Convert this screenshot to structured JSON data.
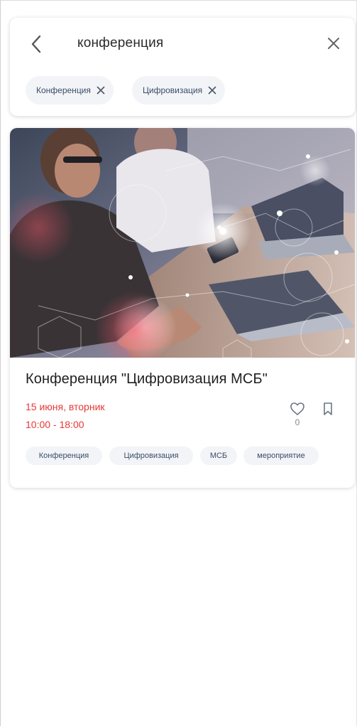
{
  "search": {
    "query": "конференция",
    "filters": [
      {
        "label": "Конференция"
      },
      {
        "label": "Цифровизация"
      }
    ]
  },
  "event": {
    "title": "Конференция \"Цифровизация МСБ\"",
    "date": "15 июня, вторник",
    "time": "10:00 - 18:00",
    "likes": "0",
    "tags": [
      "Конференция",
      "Цифровизация",
      "МСБ",
      "мероприятие"
    ],
    "accent_color": "#e53935"
  },
  "icons": {
    "back": "chevron-left-icon",
    "clear": "close-icon",
    "chip_remove": "close-icon",
    "like": "heart-icon",
    "bookmark": "bookmark-icon"
  }
}
